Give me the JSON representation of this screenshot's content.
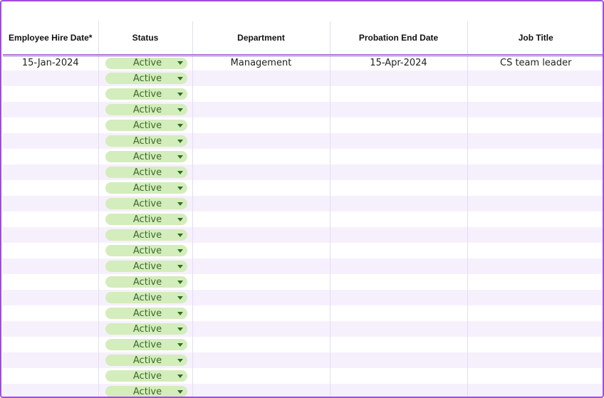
{
  "columns": [
    {
      "label": "Employee Hire Date*"
    },
    {
      "label": "Status"
    },
    {
      "label": "Department"
    },
    {
      "label": "Probation End Date"
    },
    {
      "label": "Job Title"
    }
  ],
  "status_colors": {
    "pill_bg": "#d4edbc",
    "pill_text": "#3b6b27",
    "accent": "#a24be0"
  },
  "icons": {
    "dropdown": "caret-down-icon"
  },
  "rows": [
    {
      "hire_date": "15-Jan-2024",
      "status": "Active",
      "department": "Management",
      "probation_end": "15-Apr-2024",
      "job_title": "CS team leader"
    },
    {
      "hire_date": "",
      "status": "Active",
      "department": "",
      "probation_end": "",
      "job_title": ""
    },
    {
      "hire_date": "",
      "status": "Active",
      "department": "",
      "probation_end": "",
      "job_title": ""
    },
    {
      "hire_date": "",
      "status": "Active",
      "department": "",
      "probation_end": "",
      "job_title": ""
    },
    {
      "hire_date": "",
      "status": "Active",
      "department": "",
      "probation_end": "",
      "job_title": ""
    },
    {
      "hire_date": "",
      "status": "Active",
      "department": "",
      "probation_end": "",
      "job_title": ""
    },
    {
      "hire_date": "",
      "status": "Active",
      "department": "",
      "probation_end": "",
      "job_title": ""
    },
    {
      "hire_date": "",
      "status": "Active",
      "department": "",
      "probation_end": "",
      "job_title": ""
    },
    {
      "hire_date": "",
      "status": "Active",
      "department": "",
      "probation_end": "",
      "job_title": ""
    },
    {
      "hire_date": "",
      "status": "Active",
      "department": "",
      "probation_end": "",
      "job_title": ""
    },
    {
      "hire_date": "",
      "status": "Active",
      "department": "",
      "probation_end": "",
      "job_title": ""
    },
    {
      "hire_date": "",
      "status": "Active",
      "department": "",
      "probation_end": "",
      "job_title": ""
    },
    {
      "hire_date": "",
      "status": "Active",
      "department": "",
      "probation_end": "",
      "job_title": ""
    },
    {
      "hire_date": "",
      "status": "Active",
      "department": "",
      "probation_end": "",
      "job_title": ""
    },
    {
      "hire_date": "",
      "status": "Active",
      "department": "",
      "probation_end": "",
      "job_title": ""
    },
    {
      "hire_date": "",
      "status": "Active",
      "department": "",
      "probation_end": "",
      "job_title": ""
    },
    {
      "hire_date": "",
      "status": "Active",
      "department": "",
      "probation_end": "",
      "job_title": ""
    },
    {
      "hire_date": "",
      "status": "Active",
      "department": "",
      "probation_end": "",
      "job_title": ""
    },
    {
      "hire_date": "",
      "status": "Active",
      "department": "",
      "probation_end": "",
      "job_title": ""
    },
    {
      "hire_date": "",
      "status": "Active",
      "department": "",
      "probation_end": "",
      "job_title": ""
    },
    {
      "hire_date": "",
      "status": "Active",
      "department": "",
      "probation_end": "",
      "job_title": ""
    },
    {
      "hire_date": "",
      "status": "Active",
      "department": "",
      "probation_end": "",
      "job_title": ""
    }
  ]
}
